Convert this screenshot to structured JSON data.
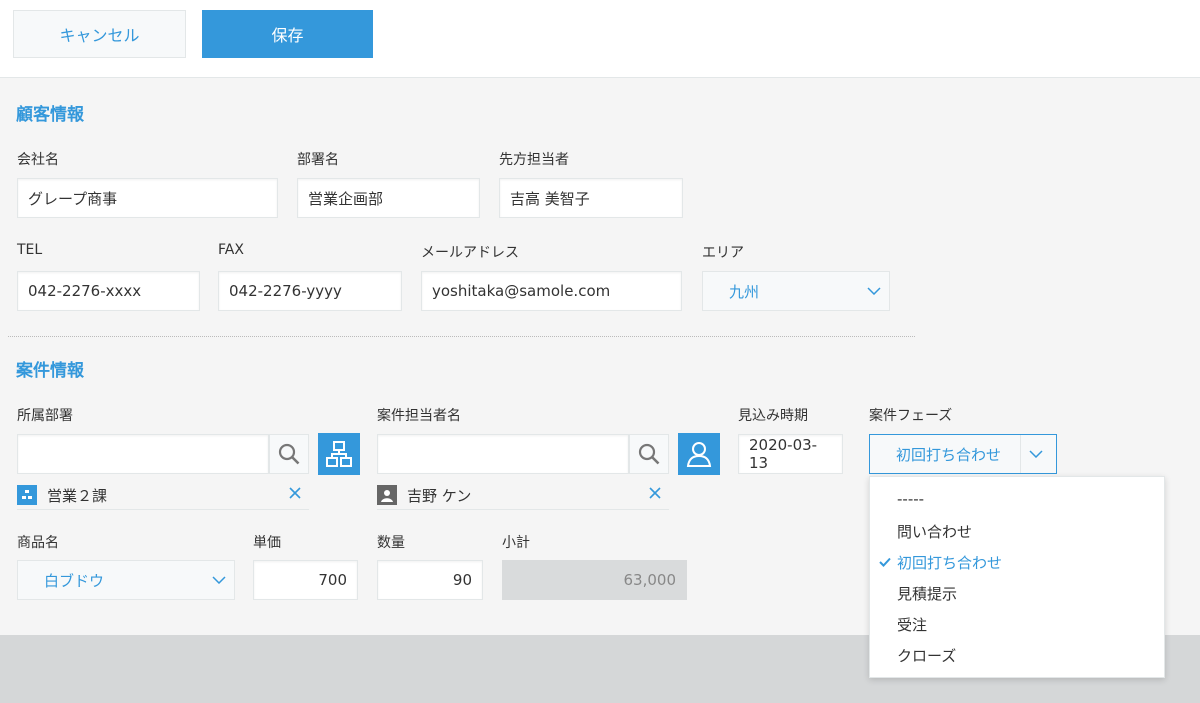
{
  "toolbar": {
    "cancel_label": "キャンセル",
    "save_label": "保存"
  },
  "customer": {
    "title": "顧客情報",
    "company": {
      "label": "会社名",
      "value": "グレープ商事"
    },
    "department": {
      "label": "部署名",
      "value": "営業企画部"
    },
    "contact": {
      "label": "先方担当者",
      "value": "吉高 美智子"
    },
    "tel": {
      "label": "TEL",
      "value": "042-2276-xxxx"
    },
    "fax": {
      "label": "FAX",
      "value": "042-2276-yyyy"
    },
    "email": {
      "label": "メールアドレス",
      "value": "yoshitaka@samole.com"
    },
    "area": {
      "label": "エリア",
      "value": "九州"
    }
  },
  "deal": {
    "title": "案件情報",
    "org": {
      "label": "所属部署",
      "value": "",
      "chip": "営業２課"
    },
    "owner": {
      "label": "案件担当者名",
      "value": "",
      "chip": "吉野 ケン"
    },
    "expected": {
      "label": "見込み時期",
      "value": "2020-03-13"
    },
    "phase": {
      "label": "案件フェーズ",
      "value": "初回打ち合わせ"
    },
    "product": {
      "label": "商品名",
      "value": "白ブドウ"
    },
    "unit_price": {
      "label": "単価",
      "value": "700"
    },
    "quantity": {
      "label": "数量",
      "value": "90"
    },
    "subtotal": {
      "label": "小計",
      "value": "63,000"
    }
  },
  "phase_options": [
    "-----",
    "問い合わせ",
    "初回打ち合わせ",
    "見積提示",
    "受注",
    "クローズ"
  ],
  "colors": {
    "accent": "#3498db",
    "form_bg": "#f5f5f5",
    "page_bg": "#d5d7d8"
  },
  "icons": [
    "search-icon",
    "org-tree-icon",
    "user-icon",
    "close-icon",
    "chevron-down-icon",
    "check-icon",
    "user-avatar-icon"
  ]
}
